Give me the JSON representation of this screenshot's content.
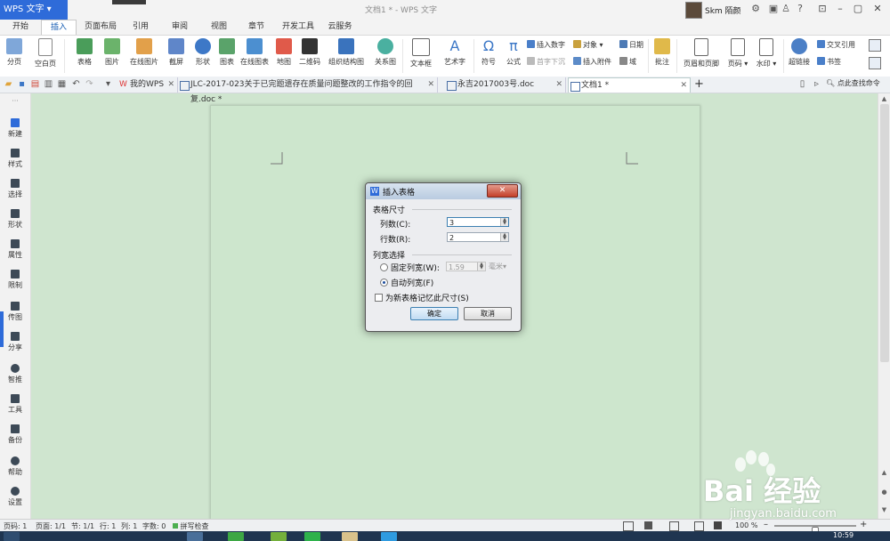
{
  "app": {
    "brand_label": "WPS 文字",
    "window_title": "文档1 * - WPS 文字",
    "user_name": "Skm 陌颜"
  },
  "menu_tabs": [
    "开始",
    "插入",
    "页面布局",
    "引用",
    "审阅",
    "视图",
    "章节",
    "开发工具",
    "云服务"
  ],
  "active_menu_tab": "插入",
  "ribbon": {
    "page_break": "分页",
    "blank_page": "空白页",
    "table": "表格",
    "picture": "图片",
    "online_picture": "在线图片",
    "screenshot": "截屏",
    "shapes": "形状",
    "chart": "图表",
    "online_chart": "在线图表",
    "map": "地图",
    "qrcode": "二维码",
    "org_chart": "组织结构图",
    "relation_chart": "关系图",
    "textbox": "文本框",
    "wordart": "艺术字",
    "symbol": "符号",
    "formula": "公式",
    "insert_number": "插入数字",
    "object": "对象",
    "date": "日期",
    "drop_cap": "首字下沉",
    "insert_attachment": "插入附件",
    "field": "域",
    "comment": "批注",
    "header_footer": "页眉和页脚",
    "page_number": "页码",
    "watermark": "水印",
    "hyperlink": "超链接",
    "cross_ref": "交叉引用",
    "bookmark": "书签"
  },
  "doc_tabs": [
    {
      "label": "我的WPS",
      "active": false
    },
    {
      "label": "JLC-2017-023关于已完题遗存在质量问题整改的工作指令的回复.doc *",
      "active": false
    },
    {
      "label": "永吉2017003号.doc",
      "active": false
    },
    {
      "label": "文档1 *",
      "active": true
    }
  ],
  "search_command": "点此查找命令",
  "sidebar": [
    "新建",
    "样式",
    "选择",
    "形状",
    "属性",
    "限制",
    "传图",
    "分享",
    "智推",
    "工具",
    "备份",
    "帮助",
    "设置"
  ],
  "dialog": {
    "title": "插入表格",
    "group_size": "表格尺寸",
    "columns_label": "列数(C):",
    "columns_value": "3",
    "rows_label": "行数(R):",
    "rows_value": "2",
    "group_width": "列宽选择",
    "fixed_width_label": "固定列宽(W):",
    "fixed_width_value": "1.59",
    "fixed_width_unit": "毫米",
    "auto_width_label": "自动列宽(F)",
    "remember_label": "为新表格记忆此尺寸(S)",
    "ok": "确定",
    "cancel": "取消",
    "fixed_selected": false,
    "auto_selected": true,
    "remember_checked": false
  },
  "status": {
    "page_no": "页码: 1",
    "pages": "页面: 1/1",
    "section": "节: 1/1",
    "row": "行: 1",
    "col": "列: 1",
    "words": "字数: 0",
    "spell": "拼写检查",
    "zoom": "100 %",
    "zoom_fraction": 0.5
  },
  "clock": "10:59",
  "watermark": {
    "main": "Bai 经验",
    "sub": "jingyan.baidu.com"
  },
  "colors": {
    "accent": "#2e6bd9",
    "page_bg": "#cfe5cf",
    "taskbar": "#1f3550"
  }
}
